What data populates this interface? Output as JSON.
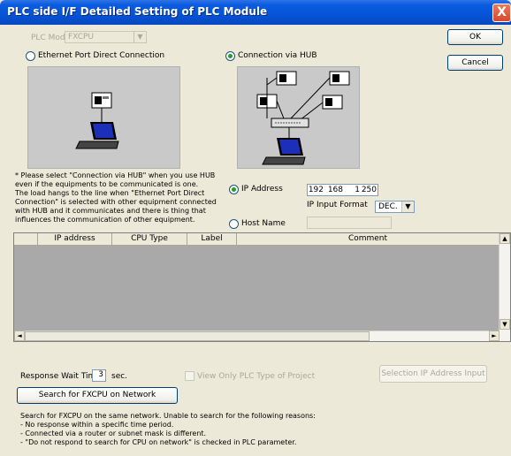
{
  "window": {
    "title": "PLC side I/F Detailed Setting of PLC Module",
    "close_glyph": "X"
  },
  "buttons": {
    "ok": "OK",
    "cancel": "Cancel",
    "search": "Search for FXCPU on Network",
    "selection_ip": "Selection IP Address Input"
  },
  "plc_mode": {
    "label": "PLC Mode",
    "value": "FXCPU"
  },
  "connection": {
    "direct_label": "Ethernet Port Direct Connection",
    "hub_label": "Connection via HUB",
    "selected": "hub"
  },
  "note_text": "* Please select \"Connection via HUB\" when you use HUB even if the equipments to be communicated is one.\nThe load hangs to the line when \"Ethernet Port Direct Connection\" is selected with other equipment connected with HUB and it communicates and there is thing that influences the communication of other equipment.",
  "address": {
    "ip_label": "IP Address",
    "ip": [
      "192",
      "168",
      "1",
      "250"
    ],
    "format_label": "IP Input Format",
    "format_value": "DEC.",
    "host_label": "Host Name",
    "host_value": "",
    "selected": "ip"
  },
  "table": {
    "columns": [
      "IP address",
      "CPU Type",
      "Label",
      "Comment"
    ],
    "rows": []
  },
  "response": {
    "label": "Response Wait Time",
    "value": "3",
    "unit": "sec."
  },
  "view_only_label": "View Only PLC Type of Project",
  "footer_text": "Search for FXCPU on the same network. Unable to search for the following reasons:\n- No response within a specific time period.\n- Connected via a router or subnet mask is different.\n- \"Do not respond to search for CPU on network\" is checked in PLC parameter.",
  "icons": {
    "combo_arrow": "▼",
    "scroll_up": "▲",
    "scroll_down": "▼",
    "scroll_left": "◄",
    "scroll_right": "►"
  }
}
